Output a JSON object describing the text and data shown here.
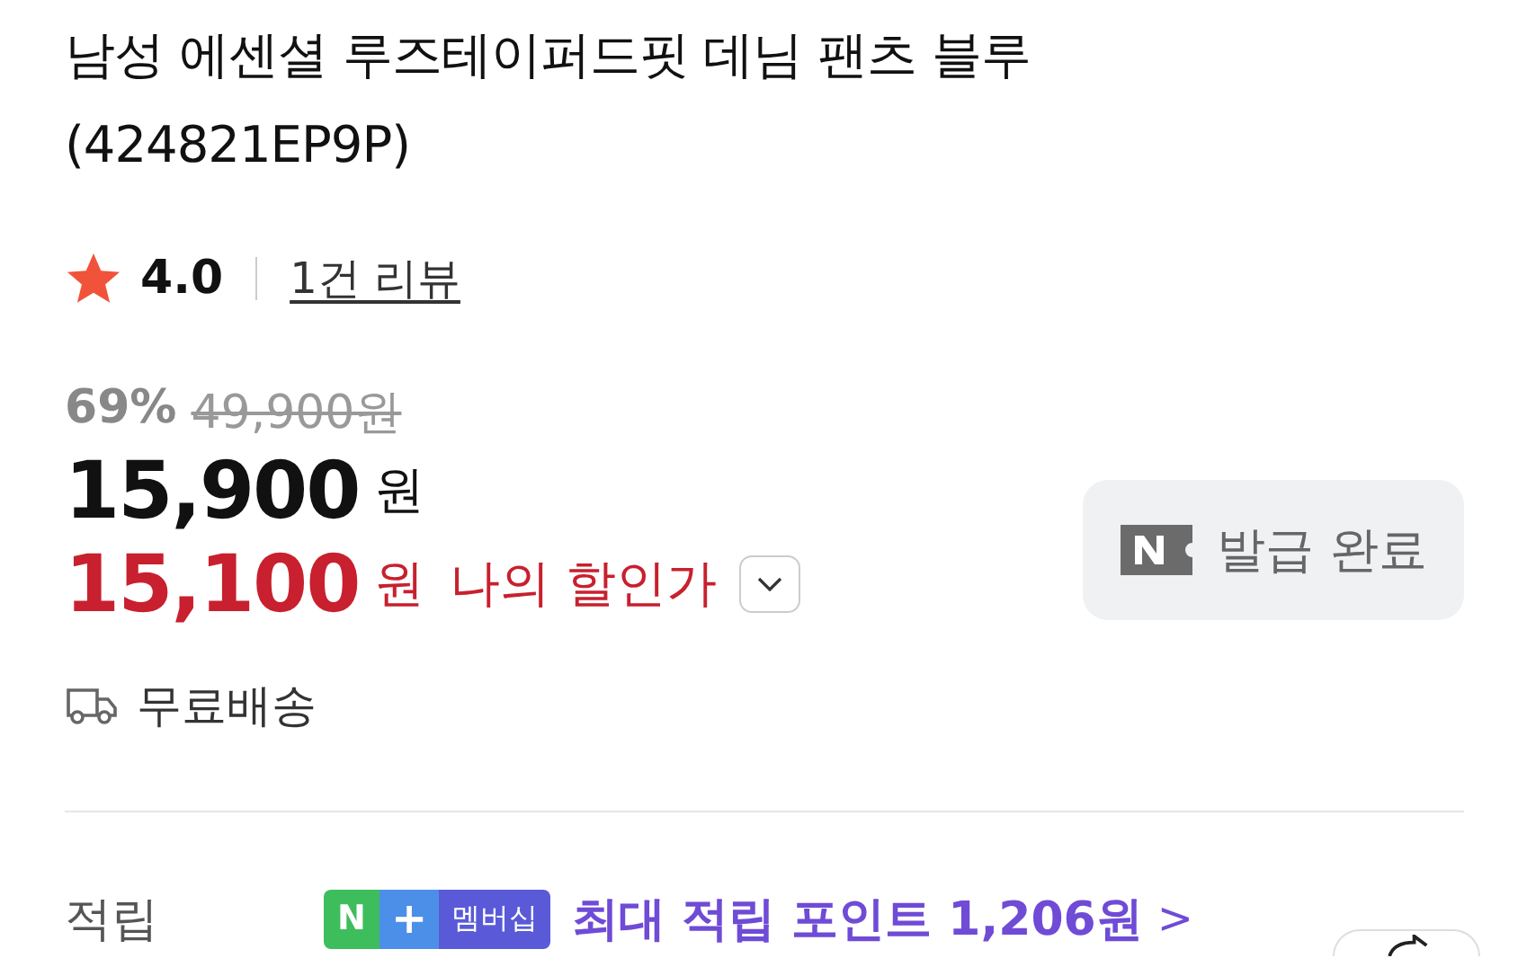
{
  "product": {
    "title": "남성 에센셜 루즈테이퍼드핏 데님 팬츠 블루 (424821EP9P)"
  },
  "rating": {
    "score": "4.0",
    "reviews": "1건 리뷰"
  },
  "price": {
    "discount": "69%",
    "original": "49,900원",
    "sale": "15,900",
    "sale_unit": "원",
    "my_price": "15,100",
    "my_unit": "원",
    "my_label": "나의 할인가",
    "expanded": false
  },
  "coupon": {
    "label": "발급 완료"
  },
  "delivery": {
    "label": "무료배송"
  },
  "points": {
    "label": "적립",
    "badge_n": "N",
    "badge_plus": "+",
    "badge_text": "멤버십",
    "text": "최대 적립 포인트 1,206원",
    "arrow": ">"
  }
}
